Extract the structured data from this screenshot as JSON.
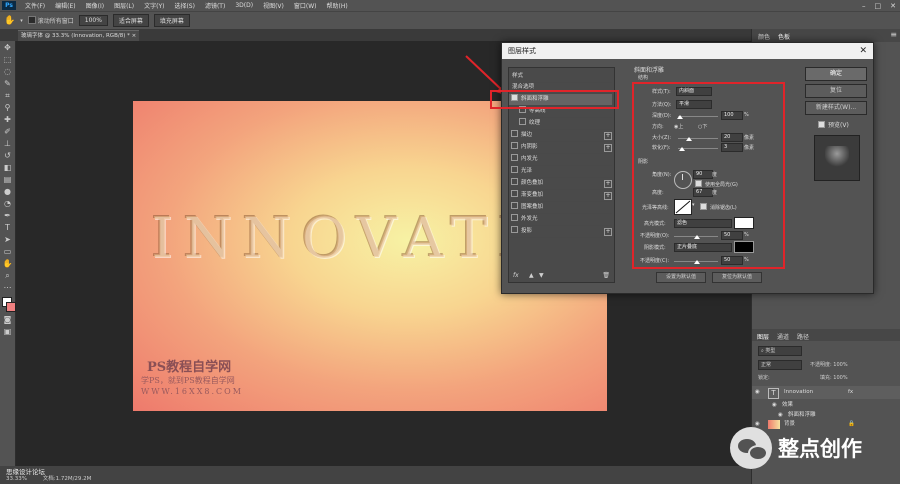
{
  "menubar": {
    "app_icon": "Ps",
    "items": [
      "文件(F)",
      "编辑(E)",
      "图像(I)",
      "图层(L)",
      "文字(Y)",
      "选择(S)",
      "滤镜(T)",
      "3D(D)",
      "视图(V)",
      "窗口(W)",
      "帮助(H)"
    ]
  },
  "options": {
    "scroll_all": "滚动所有窗口",
    "zoom": "100%",
    "fit_screen": "适合屏幕",
    "fill_screen": "填充屏幕"
  },
  "document": {
    "tab_title": "玻璃字体 @ 33.3% (Innovation, RGB/8) *",
    "canvas_text": "INNOVATIO",
    "watermark_title": "PS教程自学网",
    "watermark_sub": "学PS，就到PS教程自学网",
    "watermark_url": "WWW.16XX8.COM"
  },
  "status": {
    "zoom": "33.33%",
    "doc": "文档:1.72M/29.2M",
    "site": "思缘设计论坛"
  },
  "right_panel": {
    "tab_color": "颜色",
    "tab_swatch": "色板",
    "layer_tabs": [
      "图层",
      "通道",
      "路径"
    ],
    "kind": "类型",
    "blend": "正常",
    "opacity": "不透明度: 100%",
    "lock": "锁定:",
    "fill": "填充: 100%",
    "layers": [
      {
        "name": "Innovation",
        "fx": "fx"
      },
      {
        "name": "效果"
      },
      {
        "name": "斜面和浮雕"
      },
      {
        "name": "背景"
      }
    ],
    "brand": "整点创作"
  },
  "dialog": {
    "title": "图层样式",
    "styles_header": "样式",
    "blend_options": "混合选项",
    "effects": [
      "斜面和浮雕",
      "等高线",
      "纹理",
      "描边",
      "内阴影",
      "内发光",
      "光泽",
      "颜色叠加",
      "渐变叠加",
      "图案叠加",
      "外发光",
      "投影"
    ],
    "section_title": "斜面和浮雕",
    "structure": "结构",
    "style_label": "样式(T):",
    "style_value": "内斜面",
    "technique_label": "方法(Q):",
    "technique_value": "平滑",
    "depth_label": "深度(D):",
    "depth_value": "100",
    "direction_label": "方向:",
    "dir_up": "上",
    "dir_down": "下",
    "size_label": "大小(Z):",
    "size_value": "20",
    "soften_label": "软化(F):",
    "soften_value": "3",
    "px": "像素",
    "pct": "%",
    "shading": "阴影",
    "angle_label": "角度(N):",
    "angle_value": "90",
    "angle_unit": "度",
    "global_light": "使用全局光(G)",
    "altitude_label": "高度:",
    "altitude_value": "67",
    "gloss_label": "光泽等高线:",
    "antialias": "消除锯齿(L)",
    "highlight_label": "高光模式:",
    "highlight_value": "滤色",
    "hl_opacity_label": "不透明度(O):",
    "hl_opacity_value": "50",
    "shadow_label": "阴影模式:",
    "shadow_value": "正片叠底",
    "sh_opacity_label": "不透明度(C):",
    "sh_opacity_value": "50",
    "default_btn": "设置为默认值",
    "reset_btn": "复位为默认值",
    "ok": "确定",
    "cancel": "复位",
    "new_style": "新建样式(W)...",
    "preview": "预览(V)",
    "fx": "fx"
  }
}
